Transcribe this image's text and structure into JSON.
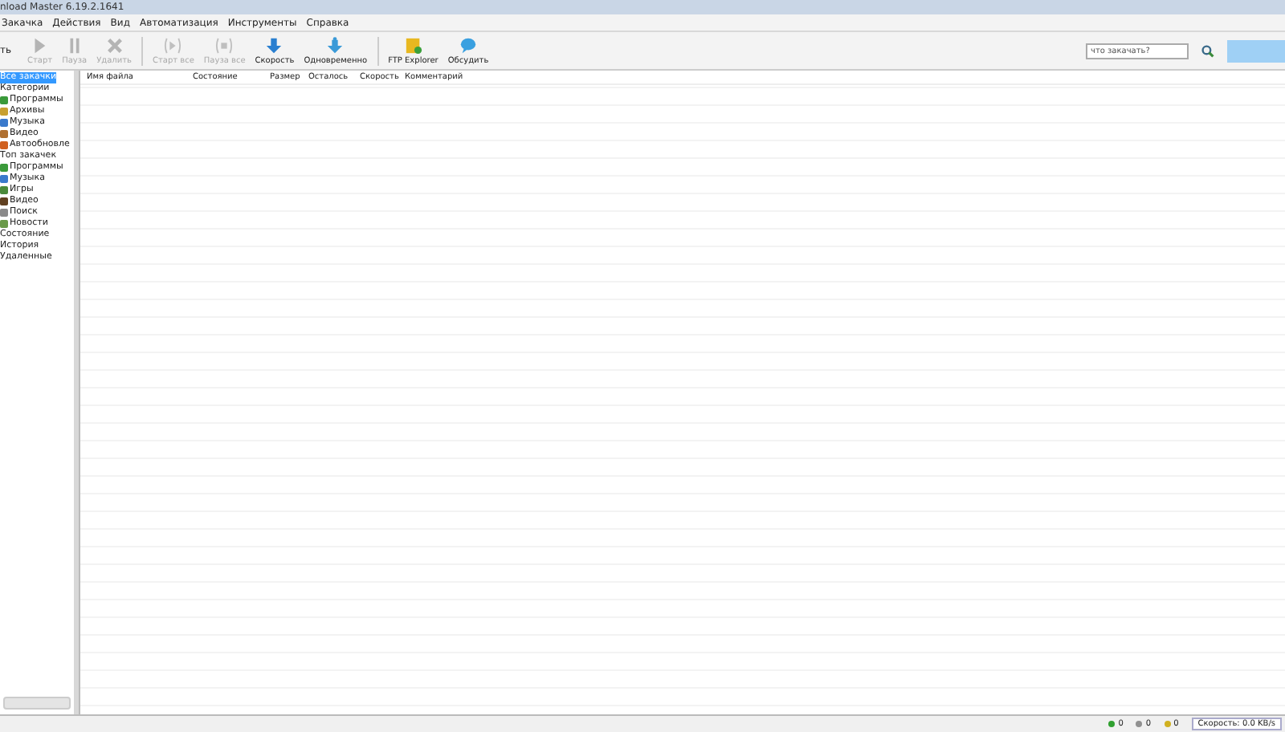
{
  "window": {
    "title": "nload Master 6.19.2.1641"
  },
  "menu": [
    "Закачка",
    "Действия",
    "Вид",
    "Автоматизация",
    "Инструменты",
    "Справка"
  ],
  "toolbar": {
    "cut_label": "ть",
    "buttons": [
      {
        "label": "Старт",
        "kind": "play",
        "disabled": true
      },
      {
        "label": "Пауза",
        "kind": "pause",
        "disabled": true
      },
      {
        "label": "Удалить",
        "kind": "delete",
        "disabled": true
      },
      {
        "label": "Старт все",
        "kind": "playall",
        "disabled": true
      },
      {
        "label": "Пауза все",
        "kind": "pauseall",
        "disabled": true
      },
      {
        "label": "Скорость",
        "kind": "speed",
        "disabled": false
      },
      {
        "label": "Одновременно",
        "kind": "parallel",
        "disabled": false
      },
      {
        "label": "FTP Explorer",
        "kind": "ftp",
        "disabled": false
      },
      {
        "label": "Обсудить",
        "kind": "chat",
        "disabled": false
      }
    ]
  },
  "search": {
    "placeholder": "что закачать?"
  },
  "sidebar": {
    "items": [
      {
        "label": "Все закачки",
        "selected": true
      },
      {
        "label": "Категории",
        "selected": false,
        "children": [
          {
            "label": "Программы",
            "selected": false,
            "color": "#3a9a3a"
          },
          {
            "label": "Архивы",
            "selected": false,
            "color": "#c8a030"
          },
          {
            "label": "Музыка",
            "selected": false,
            "color": "#3a7acc"
          },
          {
            "label": "Видео",
            "selected": false,
            "color": "#b07030"
          },
          {
            "label": "Автообновле",
            "selected": false,
            "color": "#d06020"
          }
        ]
      },
      {
        "label": "Топ закачек",
        "selected": false,
        "children": [
          {
            "label": "Программы",
            "selected": false,
            "color": "#3a9a3a"
          },
          {
            "label": "Музыка",
            "selected": false,
            "color": "#3a7acc"
          },
          {
            "label": "Игры",
            "selected": false,
            "color": "#4a8a3a"
          },
          {
            "label": "Видео",
            "selected": false,
            "color": "#604020"
          },
          {
            "label": "Поиск",
            "selected": false,
            "color": "#8a8a8a"
          },
          {
            "label": "Новости",
            "selected": false,
            "color": "#6a9a4a"
          }
        ]
      },
      {
        "label": "Состояние",
        "selected": false
      },
      {
        "label": "История",
        "selected": false
      },
      {
        "label": "Удаленные",
        "selected": false
      }
    ]
  },
  "table": {
    "columns": [
      "Имя файла",
      "Состояние",
      "Размер",
      "Осталось",
      "Скорость",
      "Комментарий"
    ]
  },
  "status_bar": {
    "counters": [
      {
        "value": "0",
        "color": "#30a030"
      },
      {
        "value": "0",
        "color": "#909090"
      },
      {
        "value": "0",
        "color": "#d0b020"
      }
    ],
    "speed": "Скорость: 0.0 KB/s"
  }
}
